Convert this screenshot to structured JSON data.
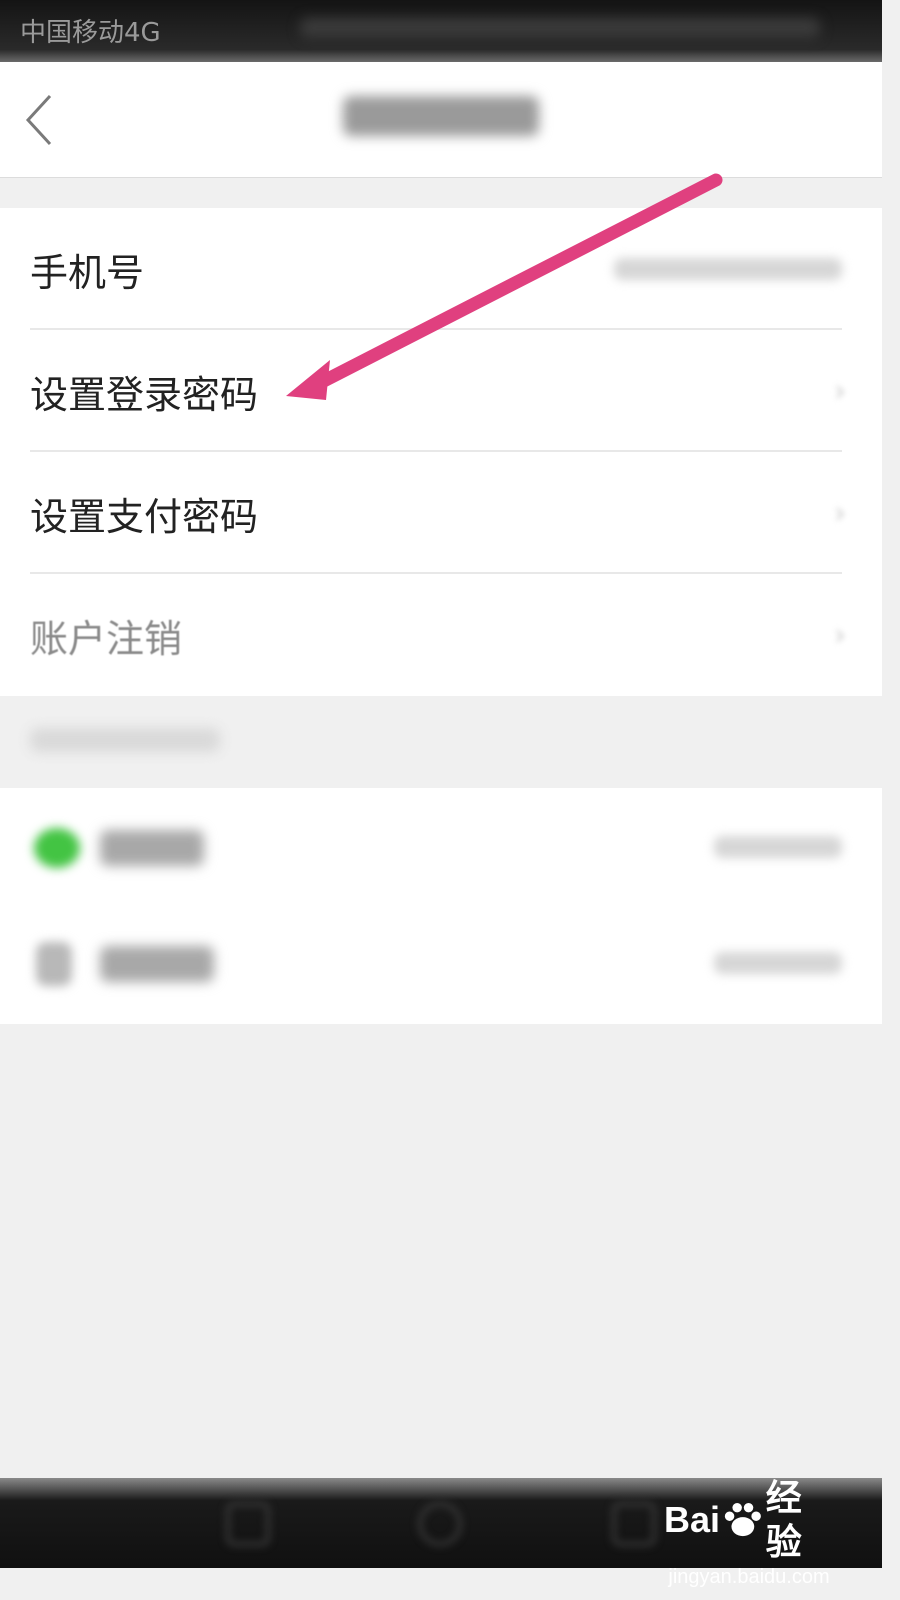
{
  "status_bar": {
    "carrier": "中国移动4G"
  },
  "nav": {
    "back_icon": "chevron-left-icon"
  },
  "account_items": [
    {
      "label": "手机号"
    },
    {
      "label": "设置登录密码"
    },
    {
      "label": "设置支付密码"
    },
    {
      "label": "账户注销"
    }
  ],
  "watermark": {
    "logo_left": "Bai",
    "logo_right": "经验",
    "url": "jingyan.baidu.com"
  },
  "colors": {
    "annotation_arrow": "#e0407f",
    "wechat_green": "#43c443",
    "background": "#f0f0f0"
  }
}
